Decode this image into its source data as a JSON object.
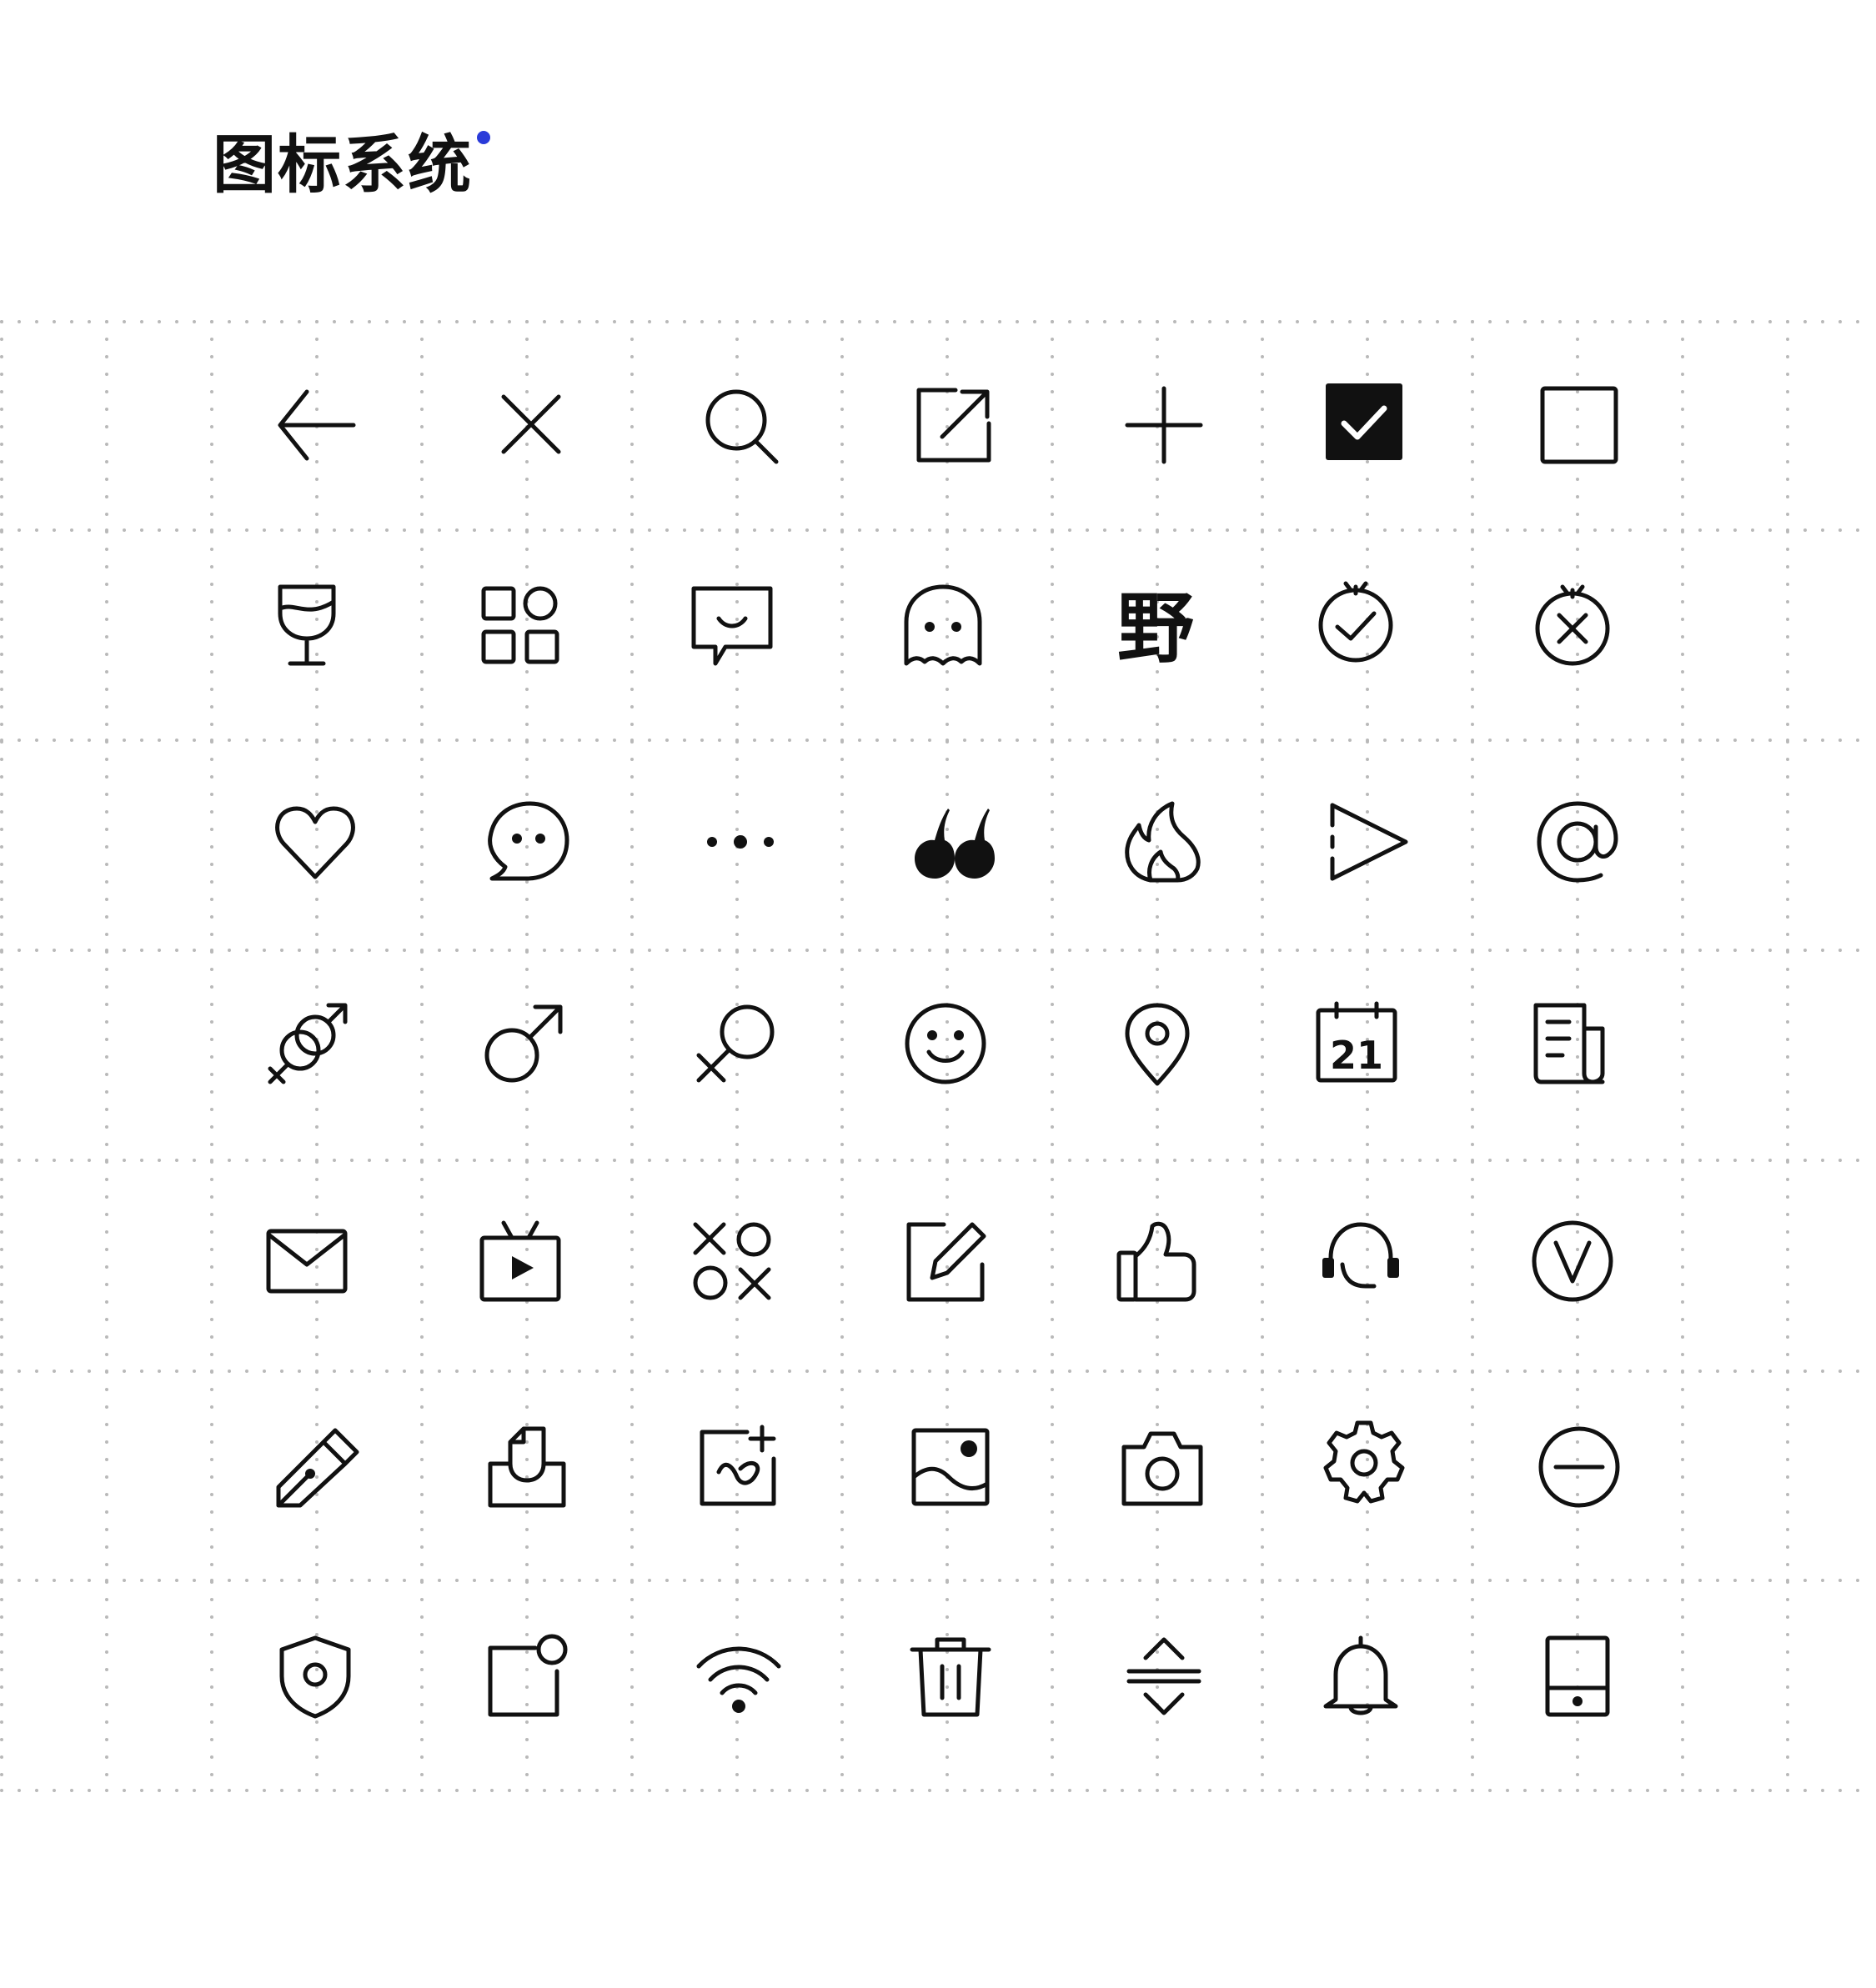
{
  "header": {
    "title": "图标系统",
    "accent_color": "#2a3bd9"
  },
  "colors": {
    "icon_stroke": "#111111",
    "grid_dot": "#b9b9b9",
    "checkbox_fill": "#2e2e2e"
  },
  "icon_rows": [
    [
      "arrow-left-icon",
      "close-icon",
      "search-icon",
      "external-link-icon",
      "plus-icon",
      "checkbox-checked-icon",
      "checkbox-empty-icon"
    ],
    [
      "wine-glass-icon",
      "app-grid-icon",
      "chat-bubble-smile-icon",
      "ghost-icon",
      "ye-character-icon",
      "clock-check-icon",
      "clock-cancel-icon"
    ],
    [
      "heart-icon",
      "chat-round-icon",
      "more-horizontal-icon",
      "quote-icon",
      "fire-icon",
      "play-dashed-icon",
      "at-sign-icon"
    ],
    [
      "gender-both-icon",
      "male-icon",
      "female-icon",
      "smile-icon",
      "location-pin-icon",
      "calendar-icon",
      "newspaper-icon"
    ],
    [
      "mail-icon",
      "tv-icon",
      "tic-tac-toe-icon",
      "edit-icon",
      "thumbs-up-icon",
      "headset-icon",
      "verified-v-icon"
    ],
    [
      "pen-nib-icon",
      "inbox-upload-icon",
      "image-add-icon",
      "image-icon",
      "camera-icon",
      "settings-gear-icon",
      "minus-circle-icon"
    ],
    [
      "shield-icon",
      "notification-square-icon",
      "wifi-icon",
      "trash-icon",
      "expand-vertical-icon",
      "bell-icon",
      "phone-icon"
    ]
  ],
  "calendar_day": "21",
  "ye_character": "野"
}
